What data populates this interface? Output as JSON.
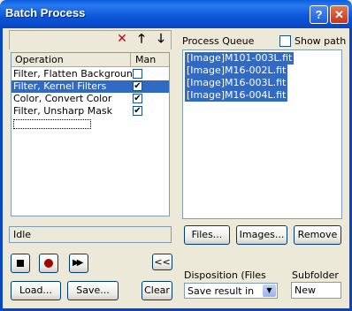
{
  "window": {
    "title": "Batch Process",
    "help": "?",
    "close": "✕"
  },
  "toolbar": {
    "delete_glyph": "✕",
    "up_glyph": "🡑",
    "down_glyph": "🡓"
  },
  "operations": {
    "col_operation": "Operation",
    "col_man": "Man",
    "rows": [
      {
        "name": "Filter, Flatten Background",
        "man": ""
      },
      {
        "name": "Filter, Kernel Filters",
        "man": "✔"
      },
      {
        "name": "Color, Convert Color",
        "man": "✔"
      },
      {
        "name": "Filter, Unsharp Mask",
        "man": "✔"
      }
    ]
  },
  "queue": {
    "label": "Process Queue",
    "show_path": "Show path",
    "items": [
      "[Image]M101-003L.fit",
      "[Image]M16-002L.fit",
      "[Image]M16-003L.fit",
      "[Image]M16-004L.fit"
    ]
  },
  "status": "Idle",
  "buttons": {
    "files": "Files...",
    "images": "Images...",
    "remove": "Remove",
    "load": "Load...",
    "save": "Save...",
    "clear": "Clear",
    "collapse": "<<"
  },
  "disposition": {
    "label": "Disposition (Files",
    "value": "Save result in",
    "arrow": "▼"
  },
  "subfolder": {
    "label": "Subfolder",
    "value": "New"
  },
  "colors": {
    "selection": "#316ac5",
    "titlebar": "#0a5fe0",
    "record": "#a00000"
  },
  "icons": [
    "delete-icon",
    "arrow-up-icon",
    "arrow-down-icon",
    "stop-icon",
    "record-icon",
    "fast-forward-icon"
  ]
}
